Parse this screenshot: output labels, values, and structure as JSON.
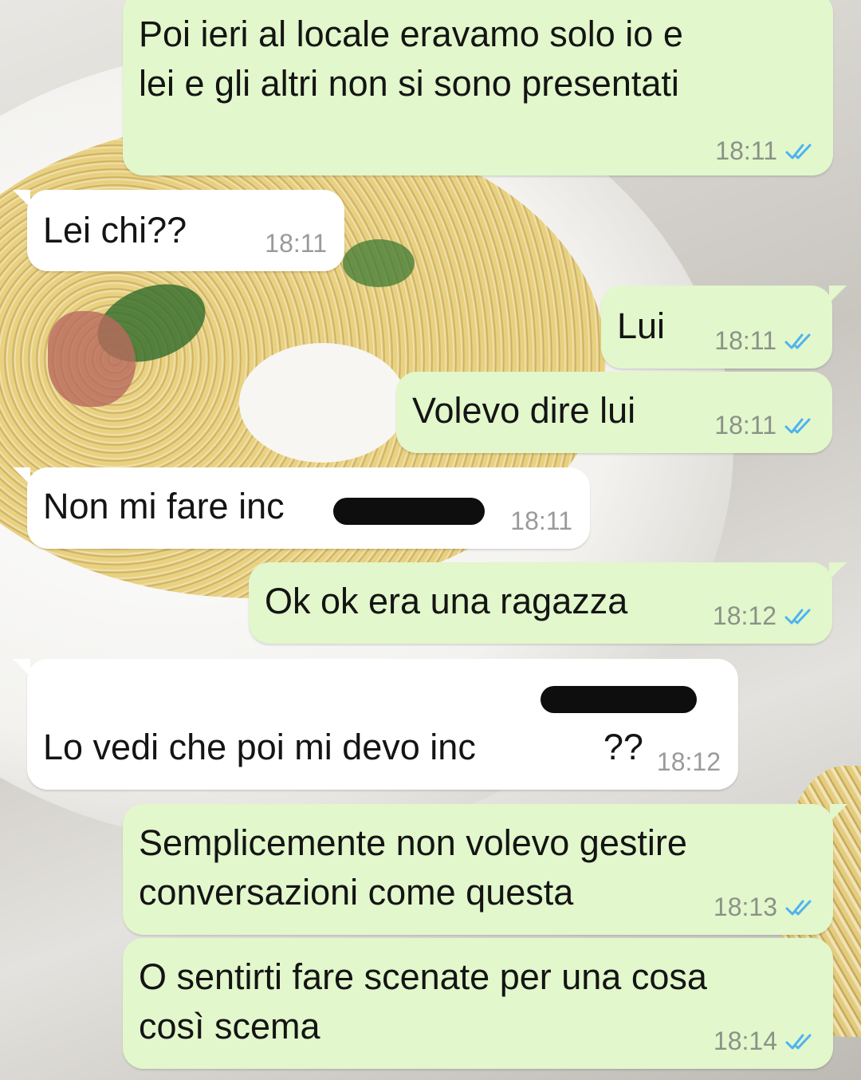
{
  "chat": {
    "messages": [
      {
        "text": "Poi ieri al locale eravamo solo io e\nlei e gli altri non si sono presentati",
        "time": "18:11"
      },
      {
        "text": "Lei chi??",
        "time": "18:11"
      },
      {
        "text": "Lui",
        "time": "18:11"
      },
      {
        "text": "Volevo dire lui",
        "time": "18:11"
      },
      {
        "text": "Non mi fare inc",
        "time": "18:11"
      },
      {
        "text": "Ok ok era una ragazza",
        "time": "18:12"
      },
      {
        "text": "Lo vedi che poi mi devo inc",
        "text_suffix": "??",
        "time": "18:12"
      },
      {
        "text": "Semplicemente non volevo gestire\nconversazioni come questa",
        "time": "18:13"
      },
      {
        "text": "O sentirti fare scenate per una cosa\ncosì scema",
        "time": "18:14"
      }
    ]
  },
  "icons": {
    "read_receipt": "double-check-icon"
  },
  "colors": {
    "outgoing_bubble": "#e2f7cb",
    "incoming_bubble": "#ffffff",
    "read_tick": "#4fb3f0"
  }
}
